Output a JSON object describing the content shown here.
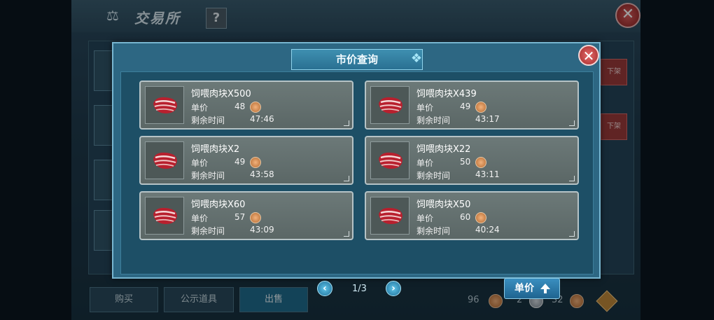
{
  "background": {
    "title": "交易所",
    "help_label": "?",
    "offshelf_label": "下架",
    "tabs": [
      {
        "label": "购买",
        "active": false
      },
      {
        "label": "公示道具",
        "active": false
      },
      {
        "label": "出售",
        "active": true
      }
    ],
    "currency": [
      {
        "amount": "96",
        "type": "copper"
      },
      {
        "amount": "2",
        "type": "silver"
      },
      {
        "amount": "32",
        "type": "copper"
      }
    ]
  },
  "modal": {
    "title": "市价查询",
    "price_label": "单价",
    "time_label": "剩余时间",
    "listings": [
      {
        "name": "饲喂肉块X500",
        "price": "48",
        "time": "47:46"
      },
      {
        "name": "饲喂肉块X439",
        "price": "49",
        "time": "43:17"
      },
      {
        "name": "饲喂肉块X2",
        "price": "49",
        "time": "43:58"
      },
      {
        "name": "饲喂肉块X22",
        "price": "50",
        "time": "43:11"
      },
      {
        "name": "饲喂肉块X60",
        "price": "57",
        "time": "43:09"
      },
      {
        "name": "饲喂肉块X50",
        "price": "60",
        "time": "40:24"
      }
    ],
    "pagination": {
      "text": "1/3"
    },
    "sort_button": "单价"
  },
  "colors": {
    "panel": "#2d6783",
    "card": "#6c7978",
    "accent": "#3a8fc0",
    "close": "#a22a2a"
  },
  "icons": [
    "scale-icon",
    "close-icon",
    "meat-icon",
    "copper-coin-icon",
    "chevron-left-icon",
    "chevron-right-icon",
    "arrow-up-icon"
  ]
}
